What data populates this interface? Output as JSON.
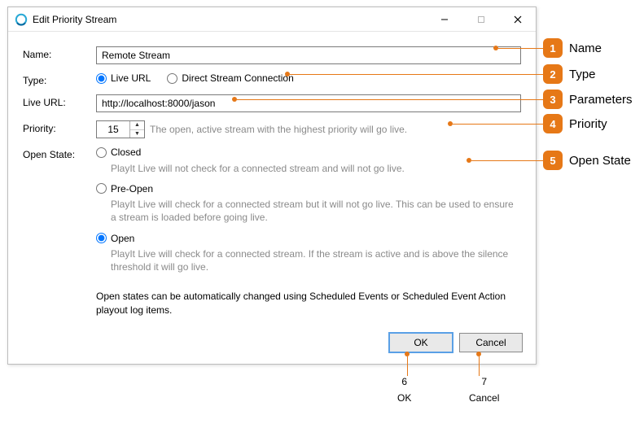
{
  "window": {
    "title": "Edit Priority Stream"
  },
  "labels": {
    "name": "Name:",
    "type": "Type:",
    "liveurl": "Live URL:",
    "priority": "Priority:",
    "openstate": "Open State:"
  },
  "fields": {
    "name_value": "Remote Stream",
    "type_live": "Live URL",
    "type_direct": "Direct Stream Connection",
    "liveurl_value": "http://localhost:8000/jason",
    "priority_value": "15",
    "priority_hint": "The open, active stream with the highest priority will go live."
  },
  "states": {
    "closed_label": "Closed",
    "closed_desc": "PlayIt Live will not check for a connected stream and will not go live.",
    "preopen_label": "Pre-Open",
    "preopen_desc": "PlayIt Live will check for a connected stream but it will not go live. This can be used to ensure a stream is loaded before going live.",
    "open_label": "Open",
    "open_desc": "PlayIt Live will check for a connected stream. If the stream is active and is above the silence threshold it will go live.",
    "note": "Open states can be automatically changed using Scheduled Events or Scheduled Event Action playout log items."
  },
  "buttons": {
    "ok": "OK",
    "cancel": "Cancel"
  },
  "callouts": {
    "c1": "Name",
    "c2": "Type",
    "c3": "Parameters",
    "c4": "Priority",
    "c5": "Open State",
    "c6": "OK",
    "c7": "Cancel",
    "n1": "1",
    "n2": "2",
    "n3": "3",
    "n4": "4",
    "n5": "5",
    "n6": "6",
    "n7": "7"
  }
}
